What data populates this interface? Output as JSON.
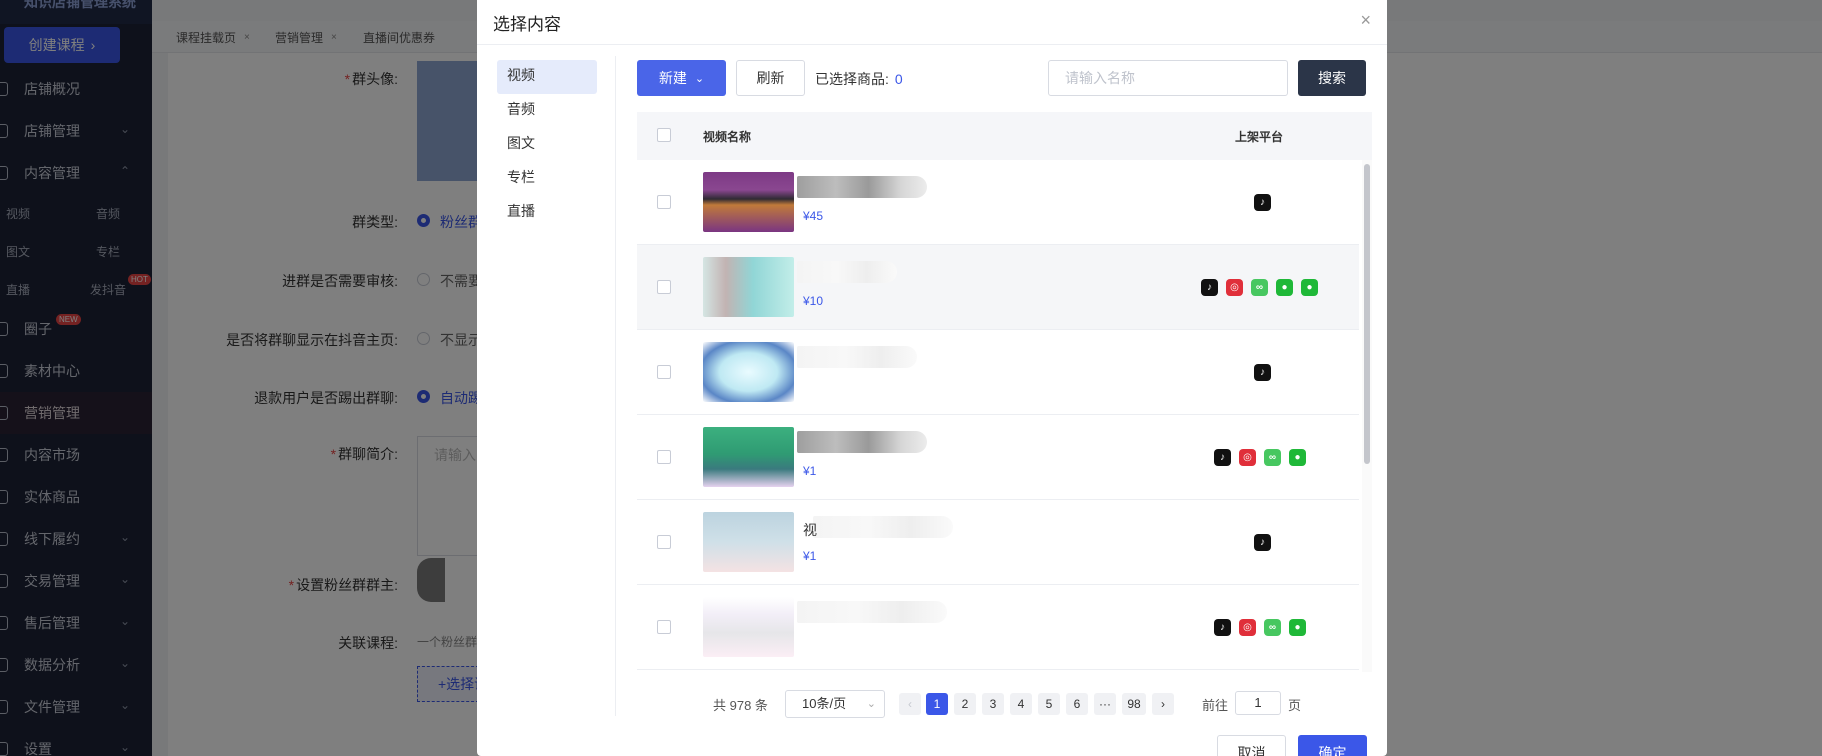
{
  "sidebar": {
    "logo_text": "知识店铺管理系统",
    "create_button": "创建课程",
    "menu": [
      {
        "label": "店铺概况",
        "chevron": ""
      },
      {
        "label": "店铺管理",
        "chevron": "⌄"
      },
      {
        "label": "内容管理",
        "chevron": "⌃"
      }
    ],
    "content_sub": {
      "video": "视频",
      "audio": "音频",
      "article": "图文",
      "column": "专栏",
      "live": "直播",
      "douyin": "发抖音",
      "hot_badge": "HOT"
    },
    "menu2": [
      {
        "label": "圈子",
        "badge": "NEW"
      },
      {
        "label": "素材中心"
      },
      {
        "label": "营销管理"
      },
      {
        "label": "内容市场"
      },
      {
        "label": "实体商品"
      },
      {
        "label": "线下履约",
        "chevron": "⌄"
      },
      {
        "label": "交易管理",
        "chevron": "⌄"
      },
      {
        "label": "售后管理",
        "chevron": "⌄"
      },
      {
        "label": "数据分析",
        "chevron": "⌄"
      },
      {
        "label": "文件管理",
        "chevron": "⌄"
      },
      {
        "label": "设置",
        "chevron": "⌄"
      }
    ]
  },
  "tabs": [
    {
      "label": "课程挂载页"
    },
    {
      "label": "营销管理"
    },
    {
      "label": "直播间优惠券"
    }
  ],
  "form": {
    "group_avatar": "群头像:",
    "group_type": "群类型:",
    "group_type_value": "粉丝群",
    "need_review": "进群是否需要审核:",
    "need_review_value": "不需要",
    "show_on_homepage": "是否将群聊显示在抖音主页:",
    "show_on_homepage_value": "不显示",
    "kick_refund": "退款用户是否踢出群聊:",
    "kick_refund_value": "自动踢",
    "group_intro": "群聊简介:",
    "group_intro_placeholder": "请输入",
    "set_owner": "设置粉丝群群主:",
    "related_course": "关联课程:",
    "related_course_hint": "一个粉丝群",
    "select_course_button": "+选择课程"
  },
  "modal": {
    "title": "选择内容",
    "categories": [
      "视频",
      "音频",
      "图文",
      "专栏",
      "直播"
    ],
    "active_category": "视频",
    "new_button": "新建",
    "refresh_button": "刷新",
    "selected_label": "已选择商品:",
    "selected_count": "0",
    "search_placeholder": "请输入名称",
    "search_button": "搜索",
    "columns": {
      "name": "视频名称",
      "platform": "上架平台"
    },
    "rows": [
      {
        "title": "",
        "price": "¥45",
        "platforms": [
          "douyin"
        ]
      },
      {
        "title": "",
        "price": "¥10",
        "platforms": [
          "douyin",
          "kuaishou",
          "link",
          "wechat",
          "wechat"
        ]
      },
      {
        "title": "",
        "price": "",
        "platforms": [
          "douyin"
        ]
      },
      {
        "title": "",
        "price": "¥1",
        "platforms": [
          "douyin",
          "kuaishou",
          "link",
          "wechat"
        ]
      },
      {
        "title": "视",
        "price": "¥1",
        "platforms": [
          "douyin"
        ]
      },
      {
        "title": "",
        "price": "",
        "platforms": [
          "douyin",
          "kuaishou",
          "link",
          "wechat"
        ]
      }
    ],
    "pagination": {
      "total": "共 978 条",
      "page_size": "10条/页",
      "pages": [
        "1",
        "2",
        "3",
        "4",
        "5",
        "6",
        "···",
        "98"
      ],
      "current": "1",
      "goto_prefix": "前往",
      "goto_value": "1",
      "goto_suffix": "页"
    },
    "cancel_button": "取消",
    "confirm_button": "确定"
  },
  "colors": {
    "primary": "#3b57e8",
    "sidebar": "#1c2236",
    "search_button": "#2b3548"
  }
}
